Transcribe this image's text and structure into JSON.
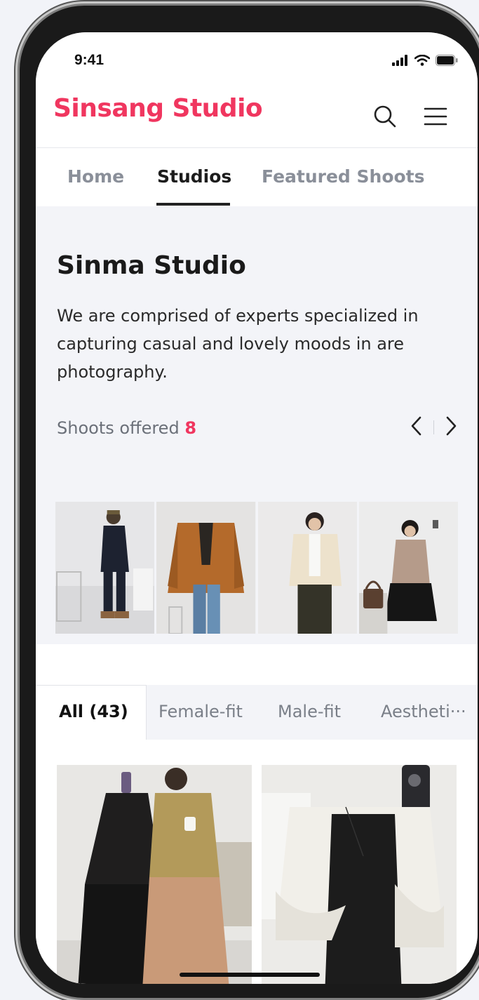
{
  "status_bar": {
    "time": "9:41",
    "icons": [
      "signal-icon",
      "wifi-icon",
      "battery-icon"
    ]
  },
  "header": {
    "brand": "Sinsang Studio",
    "brand_color": "#f0365f",
    "icons": [
      "search-icon",
      "menu-icon"
    ]
  },
  "nav": {
    "tabs": [
      {
        "label": "Home",
        "active": false
      },
      {
        "label": "Studios",
        "active": true
      },
      {
        "label": "Featured Shoots",
        "active": false
      }
    ]
  },
  "studio": {
    "name": "Sinma Studio",
    "description": "We are comprised of experts specialized in capturing casual and lovely moods in are photography.",
    "shoots_label": "Shoots offered",
    "shoots_count": "8",
    "pager_icons": [
      "chevron-left-icon",
      "chevron-right-icon"
    ]
  },
  "categories": {
    "tabs": [
      {
        "label": "All (43)",
        "active": true
      },
      {
        "label": "Female-fit",
        "active": false
      },
      {
        "label": "Male-fit",
        "active": false
      },
      {
        "label": "Aestheti···",
        "active": false
      }
    ]
  }
}
